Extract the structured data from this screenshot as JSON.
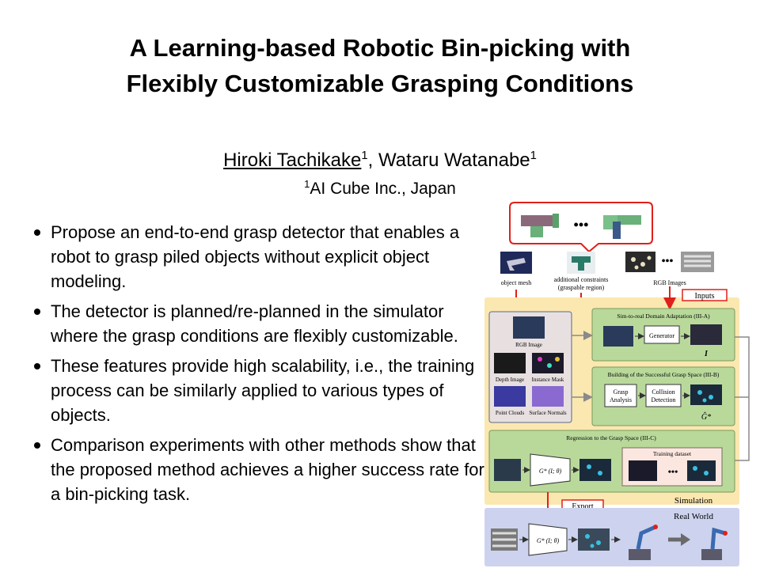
{
  "title": {
    "line1": "A Learning-based Robotic Bin-picking with",
    "line2": "Flexibly Customizable Grasping Conditions"
  },
  "authors": {
    "author1": "Hiroki Tachikake",
    "author1_sup": "1",
    "separator": ",",
    "author2": "Wataru Watanabe",
    "author2_sup": "1"
  },
  "affiliation": {
    "sup": "1",
    "text": "AI Cube Inc., Japan"
  },
  "bullets": [
    "Propose an end-to-end grasp detector that enables a robot to grasp piled objects without explicit object modeling.",
    "The detector is planned/re-planned in the simulator where the grasp conditions are flexibly customizable.",
    "These features provide high scalability, i.e., the training process can be similarly applied to various types of objects.",
    "Comparison experiments with other methods show that the proposed method achieves a higher success rate for a bin-picking task."
  ],
  "figure": {
    "ellipsis": "•••",
    "object_mesh": "object mesh",
    "additional_constraints": "additional constraints",
    "graspable_region": "(graspable region)",
    "rgb_images": "RGB Images",
    "inputs": "Inputs",
    "rgb_image": "RGB Image",
    "depth_image": "Depth Image",
    "instance_mask": "Instance Mask",
    "point_clouds": "Point Clouds",
    "surface_normals": "Surface Normals",
    "sim_to_real": "Sim-to-real Domain Adaptation (III-A)",
    "generator": "Generator",
    "i_symbol": "I",
    "building": "Building of the Successful Grasp Space (III-B)",
    "grasp_analysis_1": "Grasp",
    "grasp_analysis_2": "Analysis",
    "collision_1": "Collision",
    "collision_2": "Detection",
    "g_star": "Ĝ*",
    "regression": "Regression to the Grasp Space (III-C)",
    "g_func": "G* (I; θ)",
    "training_dataset": "Training dataset",
    "simulation": "Simulation",
    "real_world": "Real World",
    "export": "Export",
    "colors": {
      "sim_bg": "#fbe7b0",
      "module_bg": "#b9d99b",
      "module_border": "#7a9a5a",
      "real_bg": "#cdd3ee",
      "accent_red": "#e0201a",
      "image_dark": "#1f2a3a"
    }
  }
}
